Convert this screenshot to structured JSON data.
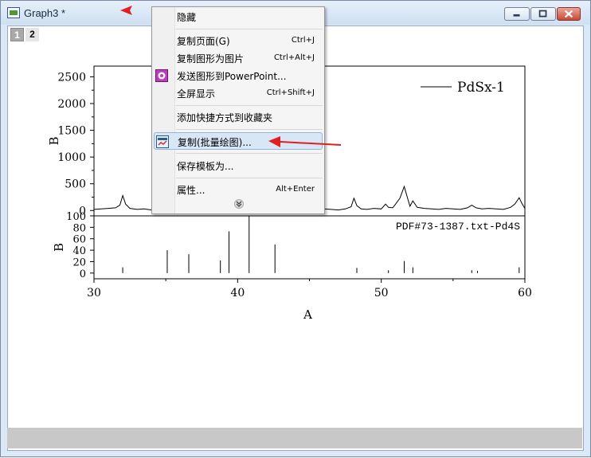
{
  "window": {
    "title": "Graph3 *",
    "layer_tabs": [
      "1",
      "2"
    ]
  },
  "menu": {
    "items": [
      {
        "label": "隐藏",
        "shortcut": ""
      },
      {
        "label": "复制页面(G)",
        "shortcut": "Ctrl+J"
      },
      {
        "label": "复制图形为图片",
        "shortcut": "Ctrl+Alt+J"
      },
      {
        "label": "发送图形到PowerPoint...",
        "shortcut": ""
      },
      {
        "label": "全屏显示",
        "shortcut": "Ctrl+Shift+J"
      },
      {
        "label": "添加快捷方式到收藏夹",
        "shortcut": ""
      },
      {
        "label": "复制(批量绘图)...",
        "shortcut": ""
      },
      {
        "label": "保存模板为...",
        "shortcut": ""
      },
      {
        "label": "属性...",
        "shortcut": "Alt+Enter"
      }
    ],
    "highlighted_index": 6,
    "more_icon": "double-chevron-down-icon"
  },
  "chart_data": [
    {
      "type": "line",
      "title": "",
      "xlabel": "",
      "ylabel": "B",
      "xlim": [
        30,
        60
      ],
      "ylim": [
        -100,
        2700
      ],
      "yticks": [
        0,
        500,
        1000,
        1500,
        2000,
        2500
      ],
      "legend": "top-right",
      "series": [
        {
          "name": "PdSx-1",
          "x": [
            30,
            30.5,
            31,
            31.5,
            31.8,
            32.0,
            32.2,
            32.5,
            33,
            33.5,
            34,
            34.5,
            35,
            35.5,
            36,
            36.5,
            37,
            37.5,
            38,
            38.5,
            39,
            39.5,
            40,
            40.5,
            41,
            41.5,
            42,
            42.5,
            43,
            43.5,
            44,
            44.5,
            45,
            45.5,
            46,
            46.5,
            47,
            47.5,
            47.9,
            48.1,
            48.3,
            48.6,
            49,
            49.5,
            50,
            50.3,
            50.5,
            50.8,
            51,
            51.3,
            51.6,
            51.8,
            52.0,
            52.2,
            52.5,
            53,
            53.5,
            54,
            54.5,
            55,
            55.5,
            56,
            56.3,
            56.6,
            57,
            57.5,
            58,
            58.5,
            59,
            59.3,
            59.6,
            59.8,
            60
          ],
          "values": [
            20,
            30,
            40,
            50,
            100,
            280,
            120,
            40,
            20,
            30,
            10,
            40,
            20,
            30,
            10,
            20,
            40,
            20,
            30,
            10,
            20,
            30,
            10,
            40,
            20,
            30,
            10,
            20,
            40,
            20,
            10,
            30,
            20,
            10,
            30,
            20,
            10,
            30,
            70,
            230,
            90,
            30,
            20,
            40,
            30,
            120,
            60,
            50,
            120,
            230,
            450,
            260,
            80,
            180,
            60,
            40,
            30,
            20,
            40,
            30,
            20,
            50,
            100,
            50,
            30,
            40,
            30,
            20,
            60,
            120,
            240,
            130,
            40
          ]
        }
      ]
    },
    {
      "type": "bar",
      "title": "",
      "xlabel": "A",
      "ylabel": "B",
      "xlim": [
        30,
        60
      ],
      "ylim": [
        -10,
        100
      ],
      "yticks": [
        0,
        20,
        40,
        60,
        80,
        100
      ],
      "xticks": [
        30,
        40,
        50,
        60
      ],
      "legend": "top-right",
      "series": [
        {
          "name": "PDF#73-1387.txt-Pd4S",
          "x": [
            32.0,
            35.1,
            36.6,
            38.8,
            39.4,
            40.8,
            42.6,
            48.3,
            50.5,
            51.6,
            52.2,
            56.3,
            56.7,
            59.6
          ],
          "values": [
            10,
            40,
            33,
            22,
            73,
            100,
            50,
            9,
            5,
            21,
            10,
            5,
            4,
            10
          ]
        }
      ]
    }
  ]
}
